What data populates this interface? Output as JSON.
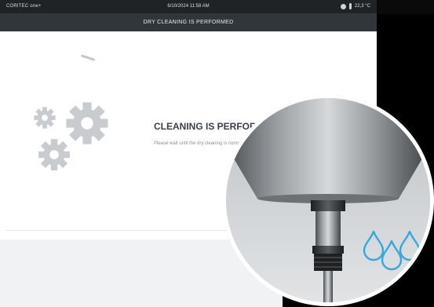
{
  "status_bar": {
    "brand": "CORITEC one+",
    "datetime": "6/10/2024 11:58 AM",
    "temperature": "22,3 °C"
  },
  "title_bar": {
    "title": "DRY CLEANING IS PERFORMED"
  },
  "main": {
    "heading": "CLEANING IS PERFORMED",
    "message": "Please wait until the dry cleaning is completed."
  },
  "icons": [
    "gears-icon",
    "water-drops-icon",
    "status-indicator-icon",
    "thermometer-icon"
  ],
  "colors": {
    "status_bar_bg": "#1f2326",
    "title_bar_bg": "#30363a",
    "gear_gray": "#c9cccf",
    "drops_blue": "#35a8e0"
  }
}
